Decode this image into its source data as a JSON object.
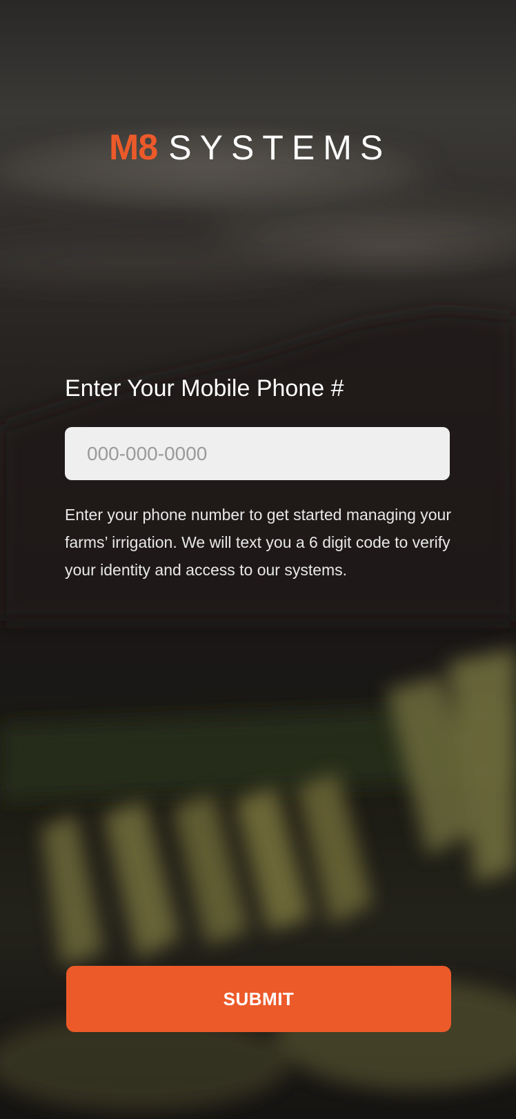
{
  "brand": {
    "logo_mark": "M8",
    "logo_word": "SYSTEMS",
    "accent_color": "#ec5a2a"
  },
  "form": {
    "heading": "Enter Your Mobile Phone #",
    "phone_placeholder": "000-000-0000",
    "phone_value": "",
    "description": "Enter your phone number to get started managing your farms’ irrigation. We will text you a 6 digit code to verify your identity and access to our systems.",
    "submit_label": "SUBMIT"
  },
  "background": {
    "scene": "blurred vineyard hills at dusk"
  }
}
